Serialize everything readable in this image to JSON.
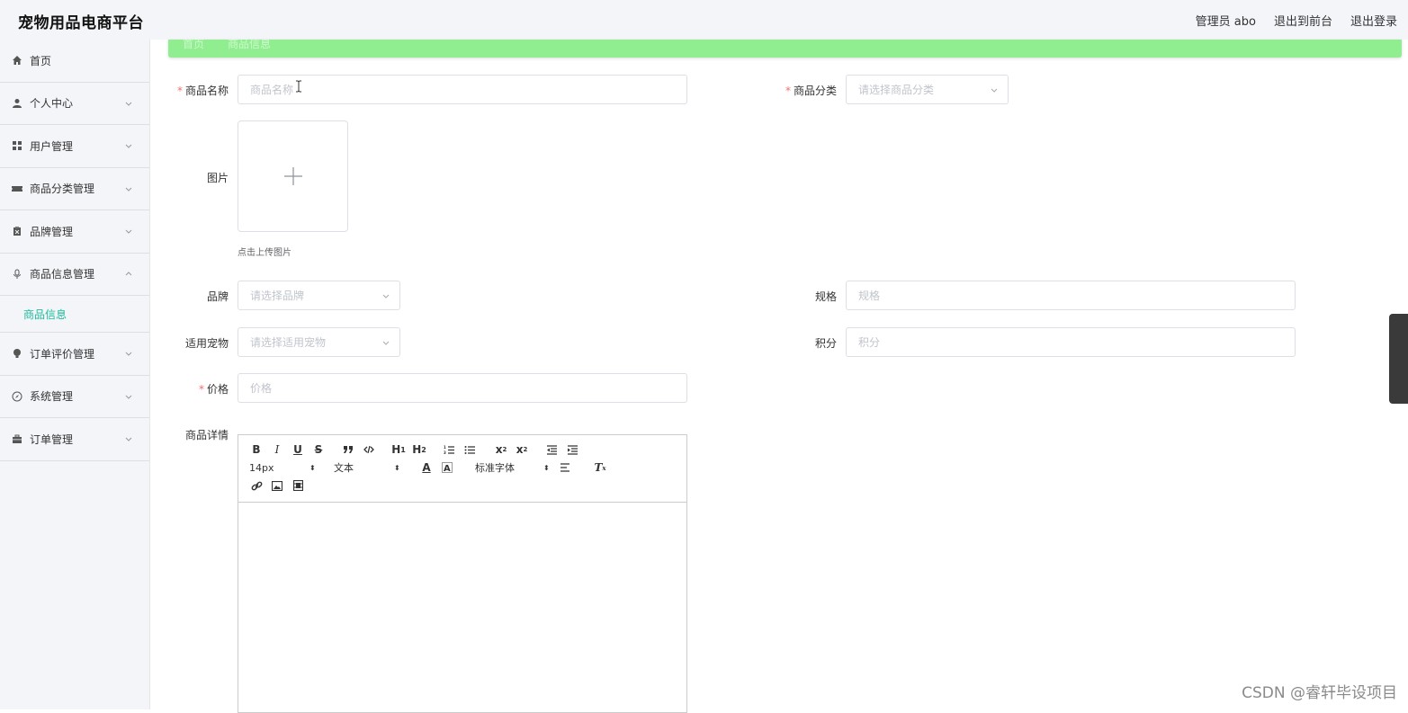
{
  "app": {
    "title": "宠物用品电商平台",
    "user_label": "管理员 abo",
    "to_front_label": "退出到前台",
    "logout_label": "退出登录"
  },
  "sidebar": {
    "items": [
      {
        "label": "首页",
        "icon": "home-icon",
        "expandable": false
      },
      {
        "label": "个人中心",
        "icon": "user-icon",
        "expandable": true
      },
      {
        "label": "用户管理",
        "icon": "grid-icon",
        "expandable": true
      },
      {
        "label": "商品分类管理",
        "icon": "ticket-icon",
        "expandable": true
      },
      {
        "label": "品牌管理",
        "icon": "clipboard-icon",
        "expandable": true
      },
      {
        "label": "商品信息管理",
        "icon": "microphone-icon",
        "expandable": true,
        "expanded": true
      },
      {
        "label": "订单评价管理",
        "icon": "bulb-icon",
        "expandable": true
      },
      {
        "label": "系统管理",
        "icon": "compass-icon",
        "expandable": true
      },
      {
        "label": "订单管理",
        "icon": "briefcase-icon",
        "expandable": true
      }
    ],
    "active_sub": "商品信息"
  },
  "breadcrumb": {
    "items": [
      "首页",
      "商品信息"
    ]
  },
  "form": {
    "name": {
      "label": "商品名称",
      "placeholder": "商品名称",
      "required": true
    },
    "category": {
      "label": "商品分类",
      "placeholder": "请选择商品分类",
      "required": true
    },
    "image": {
      "label": "图片",
      "tip": "点击上传图片"
    },
    "brand": {
      "label": "品牌",
      "placeholder": "请选择品牌"
    },
    "spec": {
      "label": "规格",
      "placeholder": "规格"
    },
    "pet": {
      "label": "适用宠物",
      "placeholder": "请选择适用宠物"
    },
    "points": {
      "label": "积分",
      "placeholder": "积分"
    },
    "price": {
      "label": "价格",
      "placeholder": "价格",
      "required": true
    },
    "detail": {
      "label": "商品详情"
    }
  },
  "editor": {
    "font_size": "14px",
    "header": "文本",
    "font_family": "标准字体"
  },
  "watermark": "CSDN @睿轩毕设项目",
  "colors": {
    "accent": "#1abc9c",
    "breadcrumb_bg": "#90ee90",
    "required": "#f56c6c"
  }
}
